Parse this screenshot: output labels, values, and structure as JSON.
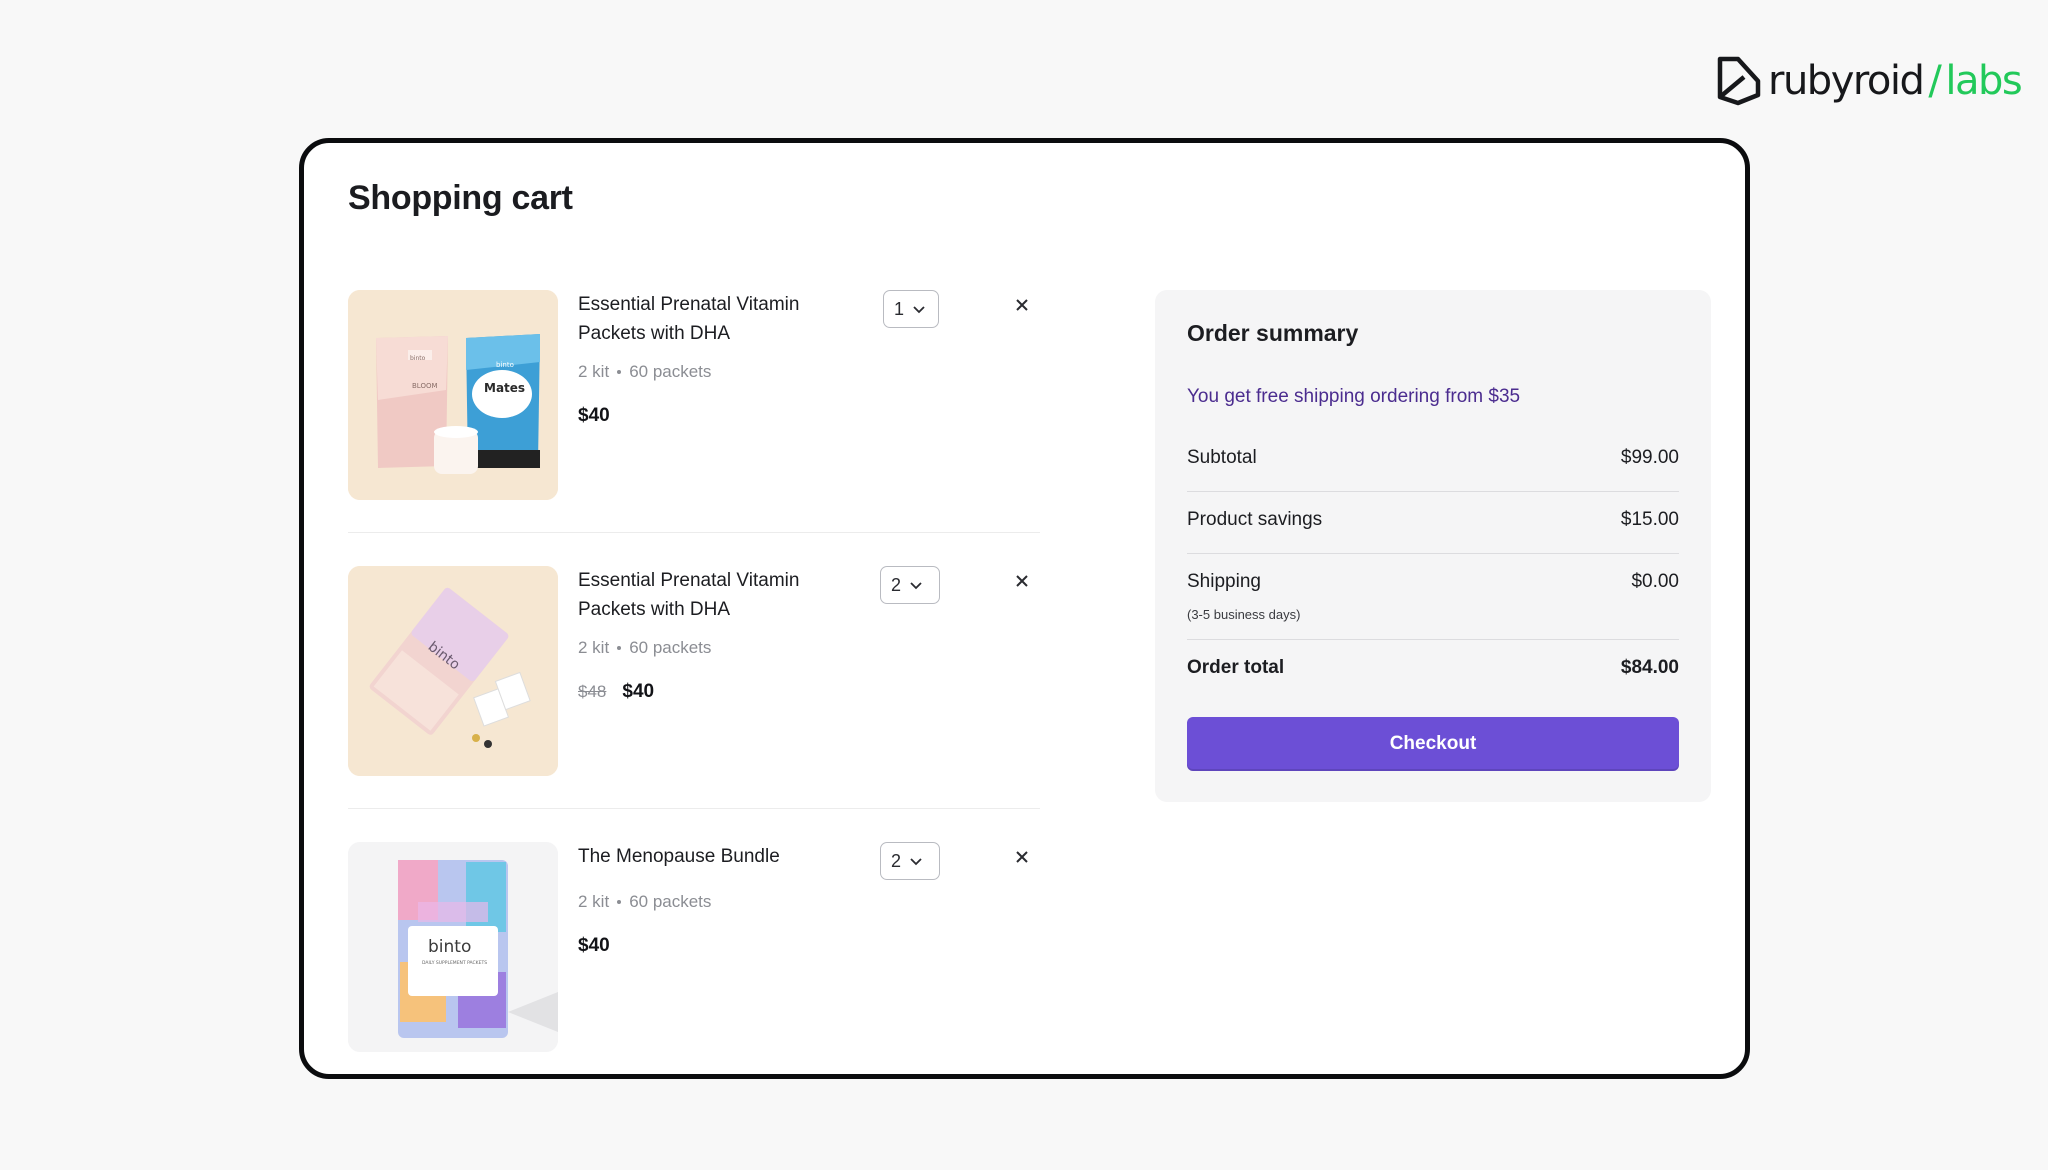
{
  "brand": {
    "name_ruby": "rubyroid",
    "slash": "/",
    "name_labs": "labs"
  },
  "page": {
    "title": "Shopping cart"
  },
  "cart": {
    "items": [
      {
        "name": "Essential Prenatal Vitamin Packets with DHA",
        "kit": "2 kit",
        "packets": "60 packets",
        "old_price": "",
        "price": "$40",
        "quantity": "1"
      },
      {
        "name": "Essential Prenatal Vitamin Packets with DHA",
        "kit": "2 kit",
        "packets": "60 packets",
        "old_price": "$48",
        "price": "$40",
        "quantity": "2"
      },
      {
        "name": "The Menopause Bundle",
        "kit": "2 kit",
        "packets": "60 packets",
        "old_price": "",
        "price": "$40",
        "quantity": "2"
      }
    ],
    "product_art": {
      "item1_left_pouch": "binto",
      "item1_left_label": "BLOOM",
      "item1_right_brand": "binto",
      "item1_right_label": "Mates",
      "item3_brand": "binto",
      "item3_label": "DAILY SUPPLEMENT PACKETS"
    }
  },
  "summary": {
    "title": "Order summary",
    "free_shipping": "You get free shipping ordering from $35",
    "subtotal_label": "Subtotal",
    "subtotal_value": "$99.00",
    "savings_label": "Product savings",
    "savings_value": "$15.00",
    "shipping_label": "Shipping",
    "shipping_value": "$0.00",
    "shipping_note": "(3-5 business days)",
    "total_label": "Order total",
    "total_value": "$84.00",
    "checkout_label": "Checkout"
  },
  "colors": {
    "accent": "#6c4fd6",
    "brand_green": "#22c95a",
    "free_shipping_text": "#4b2c8f"
  }
}
